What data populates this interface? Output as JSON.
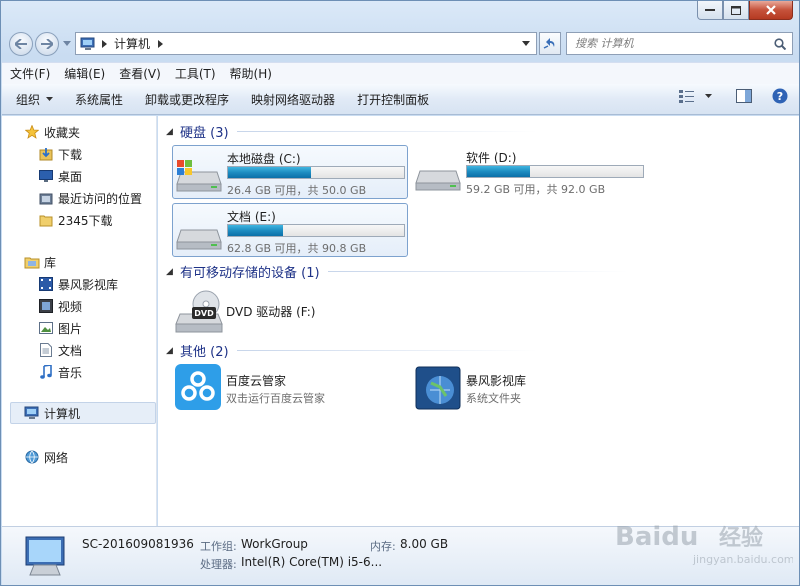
{
  "address": {
    "root_label": "计算机"
  },
  "search": {
    "placeholder": "搜索 计算机"
  },
  "menu": [
    {
      "label": "文件(F)"
    },
    {
      "label": "编辑(E)"
    },
    {
      "label": "查看(V)"
    },
    {
      "label": "工具(T)"
    },
    {
      "label": "帮助(H)"
    }
  ],
  "toolbar": {
    "organize": "组织",
    "system_props": "系统属性",
    "uninstall": "卸载或更改程序",
    "map_drive": "映射网络驱动器",
    "control_panel": "打开控制面板"
  },
  "sidebar": {
    "favorites": "收藏夹",
    "fav_items": [
      {
        "label": "下载"
      },
      {
        "label": "桌面"
      },
      {
        "label": "最近访问的位置"
      },
      {
        "label": "2345下载"
      }
    ],
    "libraries": "库",
    "lib_items": [
      {
        "label": "暴风影视库"
      },
      {
        "label": "视频"
      },
      {
        "label": "图片"
      },
      {
        "label": "文档"
      },
      {
        "label": "音乐"
      }
    ],
    "computer": "计算机",
    "network": "网络"
  },
  "groups": {
    "hard_disk": "硬盘 (3)",
    "removable": "有可移动存储的设备 (1)",
    "other": "其他 (2)"
  },
  "drives": [
    {
      "name": "本地磁盘 (C:)",
      "info": "26.4 GB 可用，共 50.0 GB",
      "used_fraction": 0.47
    },
    {
      "name": "软件 (D:)",
      "info": "59.2 GB 可用，共 92.0 GB",
      "used_fraction": 0.36
    },
    {
      "name": "文档 (E:)",
      "info": "62.8 GB 可用，共 90.8 GB",
      "used_fraction": 0.31
    }
  ],
  "dvd": {
    "name": "DVD 驱动器 (F:)",
    "badge": "DVD"
  },
  "others": [
    {
      "name": "百度云管家",
      "desc": "双击运行百度云管家"
    },
    {
      "name": "暴风影视库",
      "desc": "系统文件夹"
    }
  ],
  "details": {
    "computer_name": "SC-201609081936",
    "workgroup_label": "工作组:",
    "workgroup_value": "WorkGroup",
    "memory_label": "内存:",
    "memory_value": "8.00 GB",
    "processor_label": "处理器:",
    "processor_value": "Intel(R) Core(TM) i5-6..."
  },
  "watermark": {
    "brand": "Baidu",
    "sub": "经验",
    "url": "jingyan.baidu.com"
  },
  "colors": {
    "bar_fill": "#1d8cc1",
    "group_header": "#1e3287",
    "selection": "#e6eef8"
  }
}
